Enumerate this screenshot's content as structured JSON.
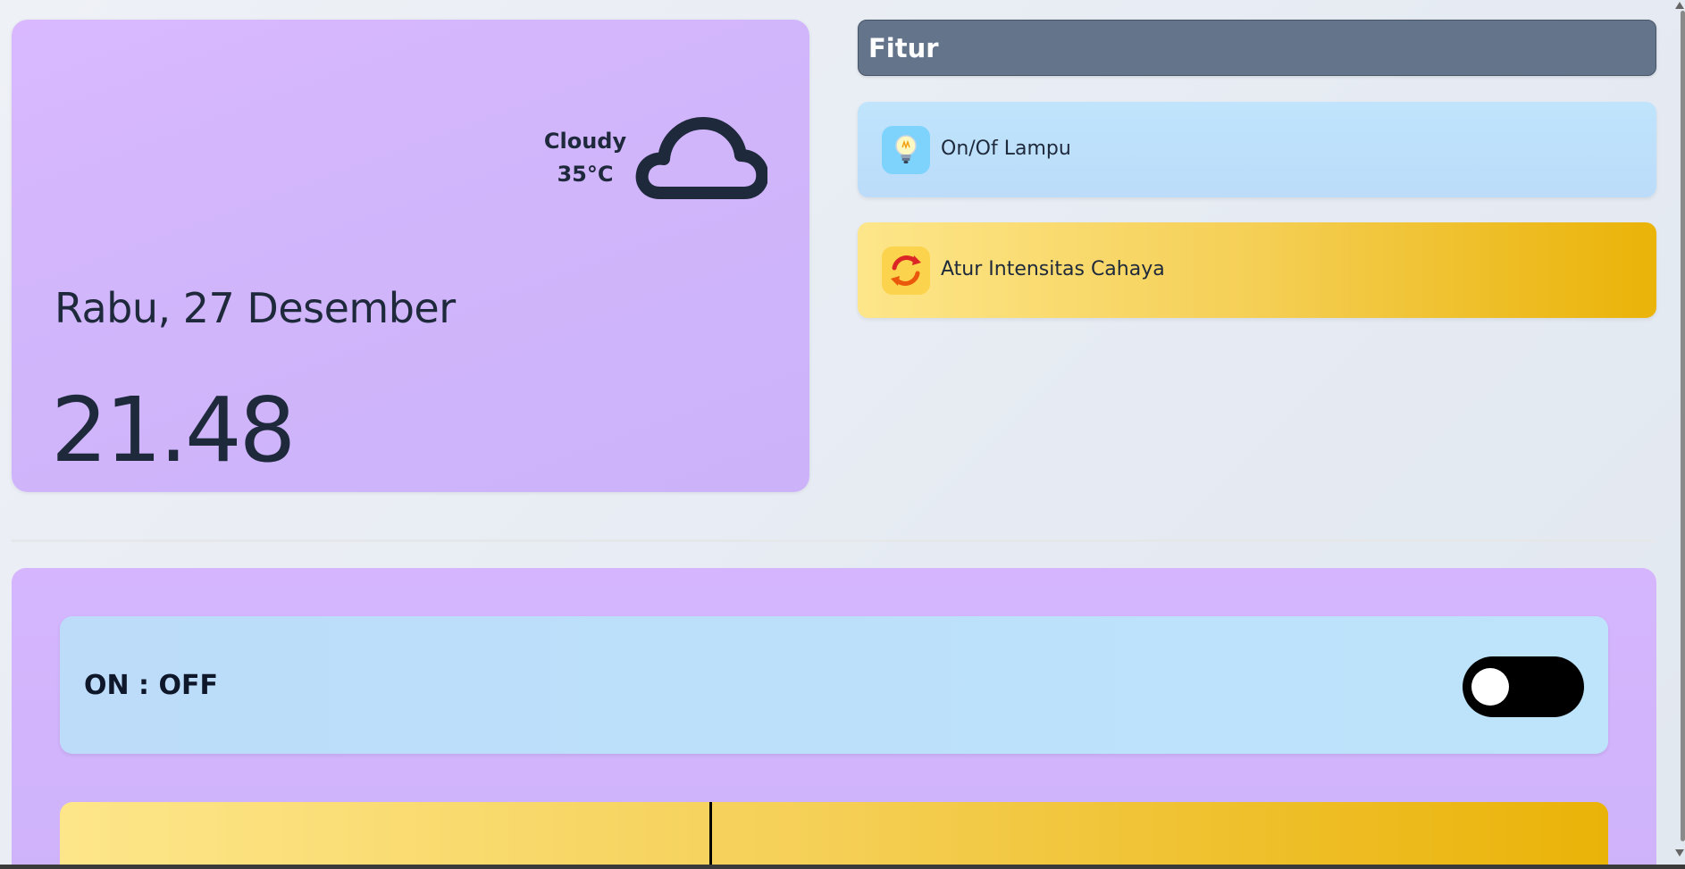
{
  "weather": {
    "condition": "Cloudy",
    "temperature": "35°C",
    "icon": "cloud-icon",
    "date": "Rabu, 27 Desember",
    "time": "21.48"
  },
  "features": {
    "title": "Fitur",
    "items": [
      {
        "label": "On/Of Lampu",
        "icon": "light-bulb-icon",
        "color": "#bde4fb"
      },
      {
        "label": "Atur Intensitas Cahaya",
        "icon": "refresh-icon",
        "color": "#eab308"
      }
    ]
  },
  "control": {
    "toggle_label": "ON : OFF",
    "toggle_state": "off",
    "intensity_fraction": 0.42
  },
  "colors": {
    "card_purple": "#d5b6fe",
    "header_slate": "#64748b",
    "panel_blue": "#bde4fb",
    "panel_yellow": "#eab308"
  }
}
